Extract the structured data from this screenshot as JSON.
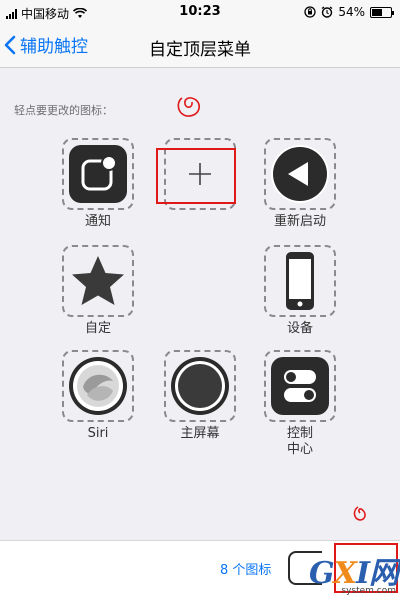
{
  "status_bar": {
    "carrier": "中国移动",
    "time": "10:23",
    "battery": "54%",
    "battery_level": 0.54
  },
  "nav": {
    "back_label": "辅助触控",
    "title": "自定顶层菜单"
  },
  "hint": "轻点要更改的图标：",
  "icons": [
    {
      "label": "通知",
      "icon": "notification-icon"
    },
    {
      "label": "",
      "icon": "plus-icon"
    },
    {
      "label": "重新启动",
      "icon": "restart-icon"
    },
    {
      "label": "自定",
      "icon": "star-icon"
    },
    {
      "label": "设备",
      "icon": "device-icon"
    },
    {
      "label": "Siri",
      "icon": "siri-icon"
    },
    {
      "label": "主屏幕",
      "icon": "home-button-icon"
    },
    {
      "label": "控制\n中心",
      "icon": "control-center-icon"
    }
  ],
  "bottom": {
    "count_label": "8 个图标"
  },
  "watermark": {
    "logo_g": "G",
    "logo_x": "X",
    "logo_i": "I",
    "logo_wang": "网",
    "site": "system.com"
  },
  "colors": {
    "accent": "#0a76f5",
    "annotation": "#e01818"
  }
}
